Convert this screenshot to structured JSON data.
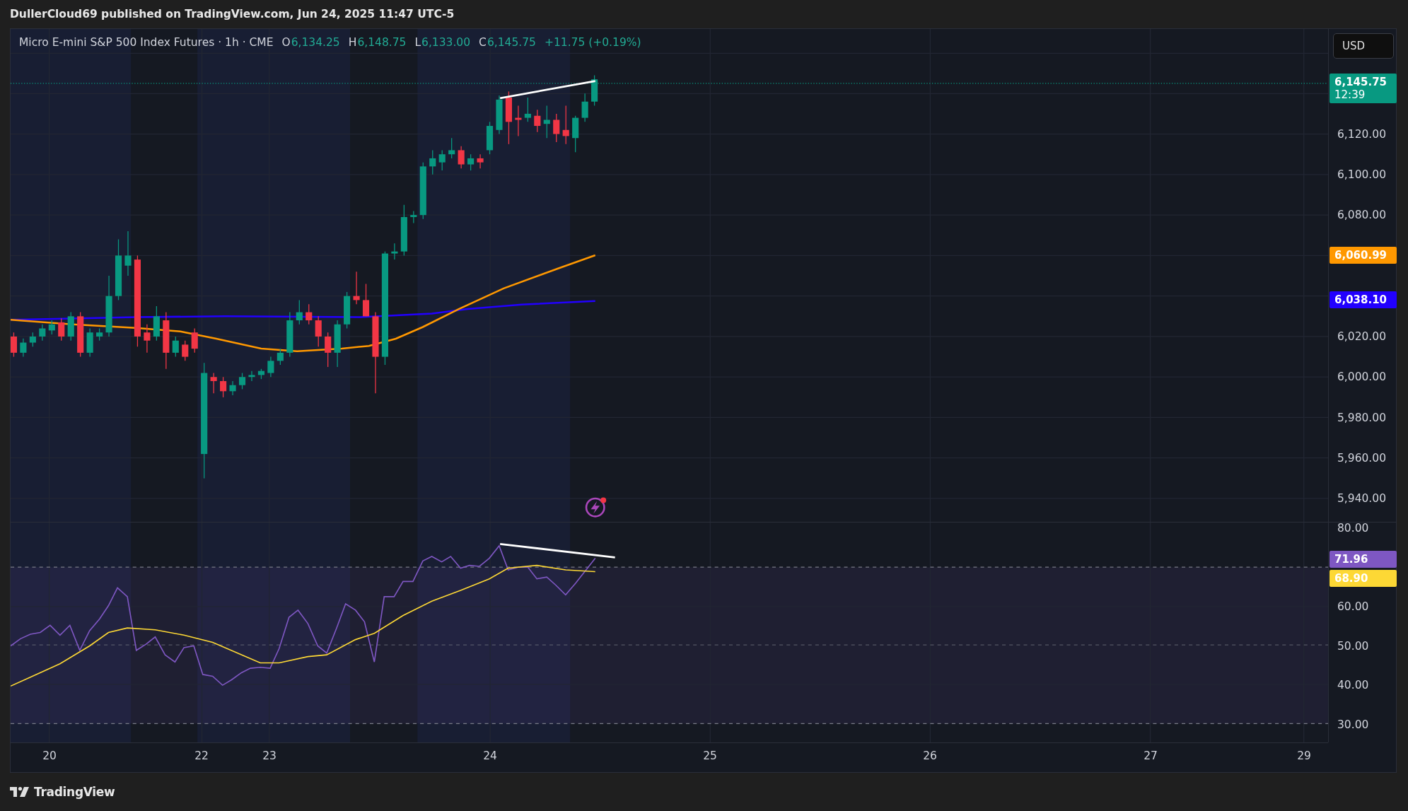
{
  "header": {
    "text": "DullerCloud69 published on TradingView.com, Jun 24, 2025 11:47 UTC-5"
  },
  "legend": {
    "symbol": "Micro E-mini S&P 500 Index Futures · 1h · CME",
    "ohlc": [
      {
        "label": "O",
        "value": "6,134.25"
      },
      {
        "label": "H",
        "value": "6,148.75"
      },
      {
        "label": "L",
        "value": "6,133.00"
      },
      {
        "label": "C",
        "value": "6,145.75"
      }
    ],
    "change": "+11.75 (+0.19%)"
  },
  "currency_button": "USD",
  "price_axis": {
    "ticks": [
      "6,120.00",
      "6,100.00",
      "6,080.00",
      "6,020.00",
      "6,000.00",
      "5,980.00",
      "5,960.00",
      "5,940.00"
    ],
    "badges": [
      {
        "kind": "last",
        "value": "6,145.75",
        "countdown": "12:39",
        "color": "#089981"
      },
      {
        "kind": "ma",
        "value": "6,060.99",
        "color": "#ff9800"
      },
      {
        "kind": "ma",
        "value": "6,038.10",
        "color": "#2200ff"
      }
    ]
  },
  "rsi_axis": {
    "ticks": [
      "80.00",
      "60.00",
      "50.00",
      "40.00",
      "30.00"
    ],
    "badges": [
      {
        "value": "71.96",
        "color": "#7e57c2"
      },
      {
        "value": "68.90",
        "color": "#fdd835"
      }
    ]
  },
  "time_axis": {
    "labels": [
      "20",
      "22",
      "23",
      "24",
      "25",
      "26",
      "27",
      "29"
    ]
  },
  "footer": {
    "brand": "TradingView"
  }
}
